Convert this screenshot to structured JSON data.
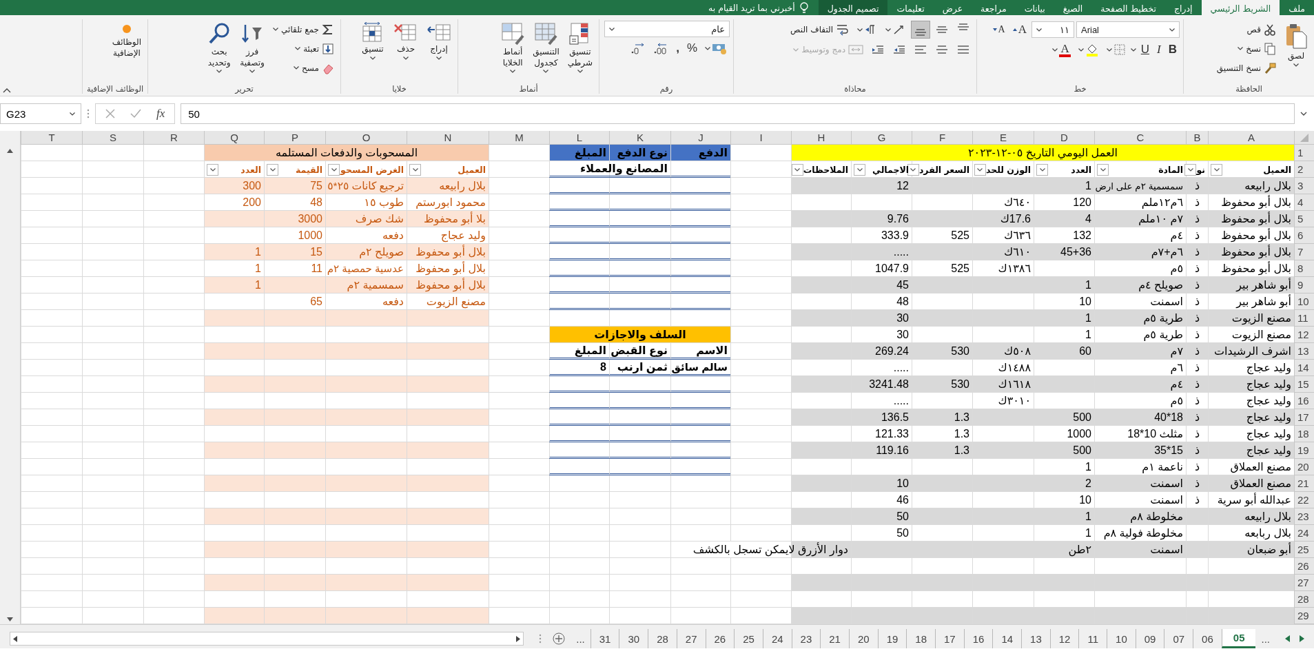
{
  "title_bar": {
    "tabs": [
      {
        "label": "ملف",
        "selected": false,
        "kind": "normal"
      },
      {
        "label": "الشريط الرئيسي",
        "selected": true,
        "kind": "normal"
      },
      {
        "label": "إدراج",
        "selected": false,
        "kind": "normal"
      },
      {
        "label": "تخطيط الصفحة",
        "selected": false,
        "kind": "normal"
      },
      {
        "label": "الصيغ",
        "selected": false,
        "kind": "normal"
      },
      {
        "label": "بيانات",
        "selected": false,
        "kind": "normal"
      },
      {
        "label": "مراجعة",
        "selected": false,
        "kind": "normal"
      },
      {
        "label": "عرض",
        "selected": false,
        "kind": "normal"
      },
      {
        "label": "تعليمات",
        "selected": false,
        "kind": "normal"
      },
      {
        "label": "تصميم الجدول",
        "selected": false,
        "kind": "contextual"
      }
    ],
    "tell_me": "أخبرني بما تريد القيام به"
  },
  "ribbon": {
    "groups": [
      {
        "kind": "clipboard",
        "label": "الحافظة",
        "paste": "لصق",
        "cut": "قص",
        "copy": "نسخ",
        "format_painter": "نسخ التنسيق"
      },
      {
        "kind": "font",
        "label": "خط",
        "font_name": "Arial",
        "font_size": "١١",
        "grow": "A",
        "shrink": "A",
        "bold": "B",
        "italic": "I",
        "underline": "U",
        "font_color": "A"
      },
      {
        "kind": "alignment",
        "label": "محاذاة",
        "vertical_align": [
          {
            "selected": false
          },
          {
            "selected": false
          },
          {
            "selected": true
          }
        ],
        "wrap_text": "التفاف النص",
        "merge": {
          "label": "دمج وتوسيط",
          "disabled": true
        }
      },
      {
        "kind": "number",
        "label": "رقم",
        "format": "عام",
        "percent": "%",
        "comma": ","
      },
      {
        "kind": "styles",
        "label": "أنماط",
        "buttons": [
          "تنسيق\nشرطي",
          "التنسيق\nكجدول",
          "أنماط\nالخلايا"
        ]
      },
      {
        "kind": "cells",
        "label": "خلايا",
        "buttons": [
          "إدراج",
          "حذف",
          "تنسيق"
        ]
      },
      {
        "kind": "editing",
        "label": "تحرير",
        "autosum": "جمع تلقائي",
        "fill": "تعبئة",
        "clear": "مسح",
        "sort": "فرز\nوتصفية",
        "find": "بحث\nوتحديد"
      },
      {
        "kind": "addins",
        "label": "الوظائف الإضافية",
        "button": "الوظائف\nالإضافية"
      }
    ]
  },
  "formula_bar": {
    "name_box": "G23",
    "function_icon": "fx",
    "formula": "50"
  },
  "sheet": {
    "columns": [
      "A",
      "B",
      "C",
      "D",
      "E",
      "F",
      "G",
      "H",
      "I",
      "J",
      "K",
      "L",
      "M",
      "N",
      "O",
      "P",
      "Q",
      "R",
      "S",
      "T"
    ],
    "row_numbers": [
      "1",
      "2",
      "3",
      "4",
      "5",
      "6",
      "7",
      "8",
      "9",
      "10",
      "11",
      "12",
      "13",
      "14",
      "15",
      "16",
      "17",
      "18",
      "19",
      "20",
      "21",
      "22",
      "23",
      "24",
      "25",
      "26",
      "27",
      "28",
      "29"
    ],
    "daily_table": {
      "title": "العمل اليومي التاريخ  ٠٥-١٢-٢٠٢٣",
      "columns": [
        "العميل",
        "نو",
        "المادة",
        "العدد",
        "الوزن للحد",
        "السعر الفرد",
        "الاجمالي",
        "الملاحظات"
      ],
      "rows": [
        {
          "column_1": "بلال رابيعه",
          "column_2": "ذ",
          "column_3": "سمسمية ٢م على ارض",
          "column_4": "1",
          "column_7": "12"
        },
        {
          "column_1": "بلال أبو محفوظ",
          "column_2": "ذ",
          "column_3": "٦م١٢ملم",
          "column_4": "120",
          "column_5": "٦٤٠ك"
        },
        {
          "column_1": "بلال أبو محفوظ",
          "column_2": "ذ",
          "column_3": "٧م ١٠ملم",
          "column_4": "4",
          "column_5": "17.6ك",
          "column_7": "9.76"
        },
        {
          "column_1": "بلال أبو محفوظ",
          "column_2": "ذ",
          "column_3": "٤م",
          "column_4": "132",
          "column_5": "٦٣٦ك",
          "column_6": "525",
          "column_7": "333.9"
        },
        {
          "column_1": "بلال أبو محفوظ",
          "column_2": "ذ",
          "column_3": "٦م+٧م",
          "column_4": "45+36",
          "column_5": "٦١٠ك",
          "column_7": "....."
        },
        {
          "column_1": "بلال أبو محفوظ",
          "column_2": "ذ",
          "column_3": "٥م",
          "column_5": "١٣٨٦ك",
          "column_6": "525",
          "column_7": "1047.9"
        },
        {
          "column_1": "أبو شاهر بير",
          "column_2": "ذ",
          "column_3": "صويلح ٤م",
          "column_4": "1",
          "column_7": "45"
        },
        {
          "column_1": "أبو شاهر بير",
          "column_2": "ذ",
          "column_3": "اسمنت",
          "column_4": "10",
          "column_7": "48"
        },
        {
          "column_1": "مصنع الزيوت",
          "column_2": "ذ",
          "column_3": "طرية ٥م",
          "column_4": "1",
          "column_7": "30"
        },
        {
          "column_1": "مصنع الزيوت",
          "column_2": "ذ",
          "column_3": "طرية ٥م",
          "column_4": "1",
          "column_7": "30"
        },
        {
          "column_1": "اشرف الرشيدات",
          "column_2": "ذ",
          "column_3": "٧م",
          "column_4": "60",
          "column_5": "٥٠٨ك",
          "column_6": "530",
          "column_7": "269.24"
        },
        {
          "column_1": "وليد عجاج",
          "column_2": "ذ",
          "column_3": "٦م",
          "column_5": "١٤٨٨ك",
          "column_7": "....."
        },
        {
          "column_1": "وليد عجاج",
          "column_2": "ذ",
          "column_3": "٤م",
          "column_5": "١٦١٨ك",
          "column_6": "530",
          "column_7": "3241.48"
        },
        {
          "column_1": "وليد عجاج",
          "column_2": "ذ",
          "column_3": "٥م",
          "column_5": "٣٠١٠ك",
          "column_7": "....."
        },
        {
          "column_1": "وليد عجاج",
          "column_2": "ذ",
          "column_3": "40*18",
          "column_4": "500",
          "column_6": "1.3",
          "column_7": "136.5"
        },
        {
          "column_1": "وليد عجاج",
          "column_2": "ذ",
          "column_3": "مثلث 10*18",
          "column_4": "1000",
          "column_6": "1.3",
          "column_7": "121.33"
        },
        {
          "column_1": "وليد عجاج",
          "column_2": "ذ",
          "column_3": "35*15",
          "column_4": "500",
          "column_6": "1.3",
          "column_7": "119.16"
        },
        {
          "column_1": "مصنع العملاق",
          "column_2": "ذ",
          "column_3": "ناعمة ١م",
          "column_4": "1"
        },
        {
          "column_1": "مصنع العملاق",
          "column_2": "ذ",
          "column_3": "اسمنت",
          "column_4": "2",
          "column_7": "10"
        },
        {
          "column_1": "عبدالله أبو سرية",
          "column_2": "ذ",
          "column_3": "اسمنت",
          "column_4": "10",
          "column_7": "46"
        },
        {
          "column_1": "بلال رابيعه",
          "column_3": "مخلوطة ٨م",
          "column_4": "1",
          "column_7": "50"
        },
        {
          "column_1": "بلال ربابعه",
          "column_3": "مخلوطة فولية ٨م",
          "column_4": "1",
          "column_7": "50"
        },
        {
          "column_1": "أبو ضبعان",
          "column_3": "اسمنت",
          "column_4": "٢طن",
          "column_8": "دوار الأزرق لايمكن تسجل بالكشف"
        }
      ]
    },
    "payments_table": {
      "headers": [
        "الدفع",
        "نوع الدفع",
        "المبلغ"
      ],
      "subheader": "المصانع والعملاء"
    },
    "advances_table": {
      "title": "السلف والاجازات",
      "headers": [
        "الاسم",
        "نوع القبض",
        "المبلغ"
      ],
      "rows": [
        [
          "سالم سائق",
          "ثمن ارنب",
          "8"
        ]
      ]
    },
    "withdrawals_table": {
      "title": "المسحوبات والدفعات المستلمه",
      "columns": [
        "العميل",
        "الغرض المسحو",
        "القيمة",
        "العدد"
      ],
      "rows": [
        {
          "column_1": "بلال رابيعه",
          "column_2": "ترجيع كانات ٢٥*٥",
          "column_3": "75",
          "column_4": "300"
        },
        {
          "column_1": "محمود ابورستم",
          "column_2": "طوب ١٥",
          "column_3": "48",
          "column_4": "200"
        },
        {
          "column_1": "بلا أبو محفوظ",
          "column_2": "شك صرف",
          "column_3": "3000"
        },
        {
          "column_1": "وليد عجاج",
          "column_2": "دفعه",
          "column_3": "1000"
        },
        {
          "column_1": "بلال أبو محفوظ",
          "column_2": "صويلح ٢م",
          "column_3": "15",
          "column_4": "1"
        },
        {
          "column_1": "بلال أبو محفوظ",
          "column_2": "عدسية حمصية ٢م",
          "column_3": "11",
          "column_4": "1"
        },
        {
          "column_1": "بلال أبو محفوظ",
          "column_2": "سمسمية ٢م",
          "column_4": "1"
        },
        {
          "column_1": "مصنع الزيوت",
          "column_2": "دفعه",
          "column_3": "65"
        }
      ]
    }
  },
  "sheet_tabs": {
    "more_before": "...",
    "tabs": [
      {
        "label": "05",
        "selected": true
      },
      {
        "label": "06",
        "selected": false
      },
      {
        "label": "07",
        "selected": false
      },
      {
        "label": "09",
        "selected": false
      },
      {
        "label": "10",
        "selected": false
      },
      {
        "label": "11",
        "selected": false
      },
      {
        "label": "12",
        "selected": false
      },
      {
        "label": "13",
        "selected": false
      },
      {
        "label": "14",
        "selected": false
      },
      {
        "label": "16",
        "selected": false
      },
      {
        "label": "17",
        "selected": false
      },
      {
        "label": "18",
        "selected": false
      },
      {
        "label": "19",
        "selected": false
      },
      {
        "label": "20",
        "selected": false
      },
      {
        "label": "21",
        "selected": false
      },
      {
        "label": "23",
        "selected": false
      },
      {
        "label": "24",
        "selected": false
      },
      {
        "label": "25",
        "selected": false
      },
      {
        "label": "26",
        "selected": false
      },
      {
        "label": "27",
        "selected": false
      },
      {
        "label": "28",
        "selected": false
      },
      {
        "label": "30",
        "selected": false
      },
      {
        "label": "31",
        "selected": false
      }
    ],
    "more_after": "..."
  }
}
